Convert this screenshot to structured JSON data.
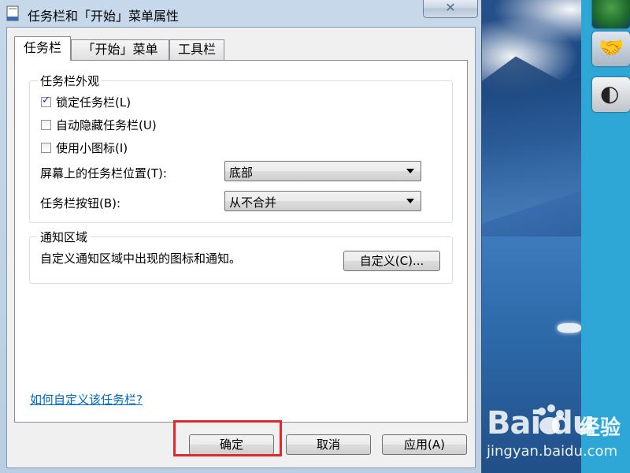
{
  "window": {
    "title": "任务栏和「开始」菜单属性",
    "close_symbol": "✕"
  },
  "tabs": [
    {
      "label": "任务栏",
      "active": true
    },
    {
      "label": "「开始」菜单",
      "active": false
    },
    {
      "label": "工具栏",
      "active": false
    }
  ],
  "appearance": {
    "group_title": "任务栏外观",
    "checkboxes": [
      {
        "label": "锁定任务栏(L)",
        "checked": true
      },
      {
        "label": "自动隐藏任务栏(U)",
        "checked": false
      },
      {
        "label": "使用小图标(I)",
        "checked": false
      }
    ],
    "position_label": "屏幕上的任务栏位置(T):",
    "position_value": "底部",
    "buttons_label": "任务栏按钮(B):",
    "buttons_value": "从不合并"
  },
  "notification": {
    "group_title": "通知区域",
    "description": "自定义通知区域中出现的图标和通知。",
    "customize_button": "自定义(C)..."
  },
  "help_link": "如何自定义该任务栏?",
  "footer": {
    "ok": "确定",
    "cancel": "取消",
    "apply": "应用(A)"
  },
  "watermark": {
    "logo": "Bai du",
    "brand": "经验",
    "url": "jingyan.baidu.com"
  },
  "colors": {
    "highlight": "#e0282e",
    "link": "#0066cc",
    "gadget_bar": "#2fa7d6"
  }
}
